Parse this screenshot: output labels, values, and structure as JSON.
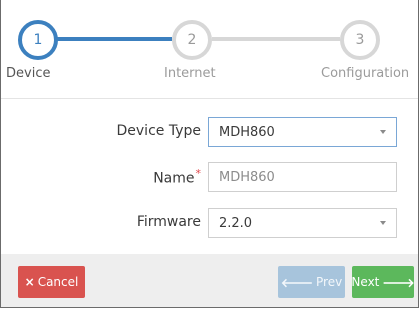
{
  "steps": [
    {
      "number": "1",
      "label": "Device"
    },
    {
      "number": "2",
      "label": "Internet"
    },
    {
      "number": "3",
      "label": "Configuration"
    }
  ],
  "active_step": 1,
  "form": {
    "device_type_label": "Device Type",
    "device_type_value": "MDH860",
    "name_label": "Name",
    "name_required_mark": "*",
    "name_value": "MDH860",
    "firmware_label": "Firmware",
    "firmware_value": "2.2.0"
  },
  "footer": {
    "cancel_icon": "×",
    "cancel_label": "Cancel",
    "prev_icon": "🡐",
    "prev_label": "Prev",
    "next_label": "Next",
    "next_icon": "🡒"
  },
  "colors": {
    "active": "#3c80bf",
    "inactive": "#d7d7d7",
    "cancel": "#d9534f",
    "prev": "#a7c4dc",
    "next": "#5cb85c"
  }
}
